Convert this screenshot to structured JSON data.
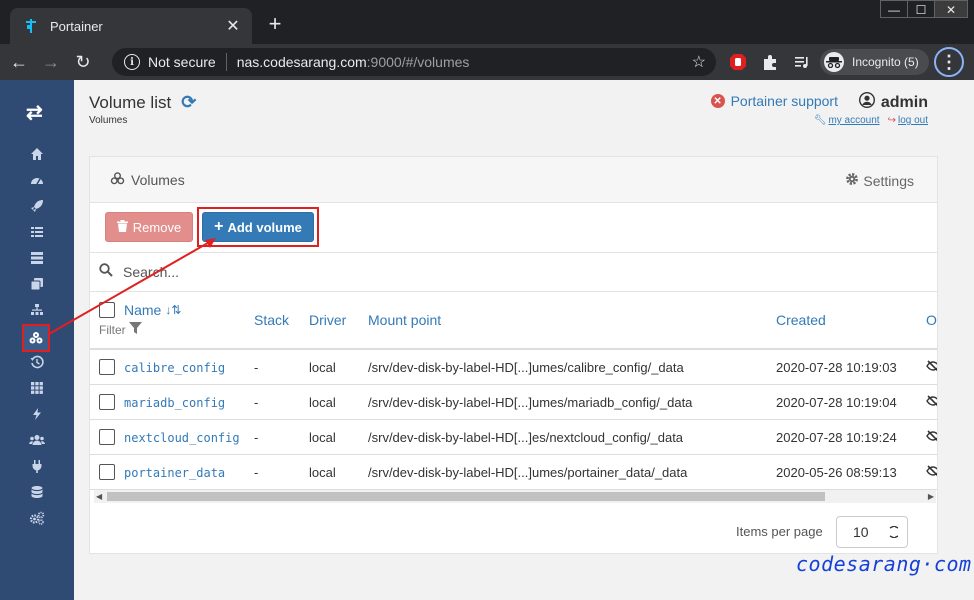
{
  "browser": {
    "tab_title": "Portainer",
    "window_controls": [
      "—",
      "☐",
      "✕"
    ],
    "security_label": "Not secure",
    "url_host": "nas.codesarang.com",
    "url_path": ":9000/#/volumes",
    "profile_label": "Incognito (5)"
  },
  "header": {
    "title": "Volume list",
    "breadcrumb": "Volumes",
    "support_label": "Portainer support",
    "username": "admin",
    "my_account_label": "my account",
    "logout_label": "log out"
  },
  "sidebar": {
    "items": [
      {
        "icon": "home-icon"
      },
      {
        "icon": "dashboard-icon"
      },
      {
        "icon": "rocket-icon"
      },
      {
        "icon": "list-icon"
      },
      {
        "icon": "server-icon"
      },
      {
        "icon": "clone-icon"
      },
      {
        "icon": "sitemap-icon"
      },
      {
        "icon": "cubes-icon",
        "active": true
      },
      {
        "icon": "history-icon"
      },
      {
        "icon": "th-icon"
      },
      {
        "icon": "bolt-icon"
      },
      {
        "icon": "users-icon"
      },
      {
        "icon": "plug-icon"
      },
      {
        "icon": "database-icon"
      },
      {
        "icon": "cogs-icon"
      }
    ]
  },
  "panel": {
    "title": "Volumes",
    "settings_label": "Settings",
    "remove_label": "Remove",
    "add_label": "Add volume",
    "search_placeholder": "Search...",
    "filter_label": "Filter",
    "columns": [
      "Name",
      "Stack",
      "Driver",
      "Mount point",
      "Created",
      "O"
    ],
    "rows": [
      {
        "name": "calibre_config",
        "stack": "-",
        "driver": "local",
        "mount": "/srv/dev-disk-by-label-HD[...]umes/calibre_config/_data",
        "created": "2020-07-28 10:19:03"
      },
      {
        "name": "mariadb_config",
        "stack": "-",
        "driver": "local",
        "mount": "/srv/dev-disk-by-label-HD[...]umes/mariadb_config/_data",
        "created": "2020-07-28 10:19:04"
      },
      {
        "name": "nextcloud_config",
        "stack": "-",
        "driver": "local",
        "mount": "/srv/dev-disk-by-label-HD[...]es/nextcloud_config/_data",
        "created": "2020-07-28 10:19:24"
      },
      {
        "name": "portainer_data",
        "stack": "-",
        "driver": "local",
        "mount": "/srv/dev-disk-by-label-HD[...]umes/portainer_data/_data",
        "created": "2020-05-26 08:59:13"
      }
    ],
    "items_per_page_label": "Items per page",
    "items_per_page_value": "10"
  },
  "watermark": "codesarang·com",
  "colors": {
    "sidebar": "#2f4a73",
    "primary": "#337ab7",
    "danger": "#d9534f",
    "annotation": "#e02020",
    "watermark": "#1540d8"
  }
}
